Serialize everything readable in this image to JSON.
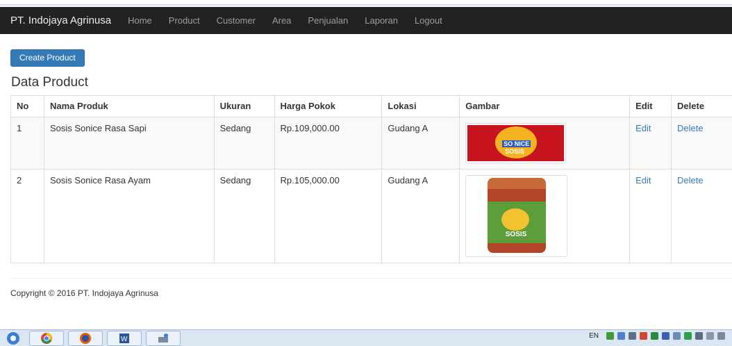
{
  "navbar": {
    "brand": "PT. Indojaya Agrinusa",
    "items": [
      "Home",
      "Product",
      "Customer",
      "Area",
      "Penjualan",
      "Laporan",
      "Logout"
    ]
  },
  "create_button": "Create Product",
  "heading": "Data Product",
  "table": {
    "headers": [
      "No",
      "Nama Produk",
      "Ukuran",
      "Harga Pokok",
      "Lokasi",
      "Gambar",
      "Edit",
      "Delete"
    ],
    "rows": [
      {
        "no": "1",
        "nama": "Sosis Sonice Rasa Sapi",
        "ukuran": "Sedang",
        "harga": "Rp.109,000.00",
        "lokasi": "Gudang A",
        "edit": "Edit",
        "delete": "Delete"
      },
      {
        "no": "2",
        "nama": "Sosis Sonice Rasa Ayam",
        "ukuran": "Sedang",
        "harga": "Rp.105,000.00",
        "lokasi": "Gudang A",
        "edit": "Edit",
        "delete": "Delete"
      }
    ]
  },
  "images": {
    "img1_text1": "SO NICE",
    "img1_text2": "SOSIS",
    "img2_text": "SOSIS"
  },
  "footer": "Copyright © 2016 PT. Indojaya Agrinusa",
  "taskbar": {
    "lang": "EN",
    "icons": [
      "chrome-icon",
      "firefox-icon",
      "word-icon",
      "app-icon"
    ]
  }
}
